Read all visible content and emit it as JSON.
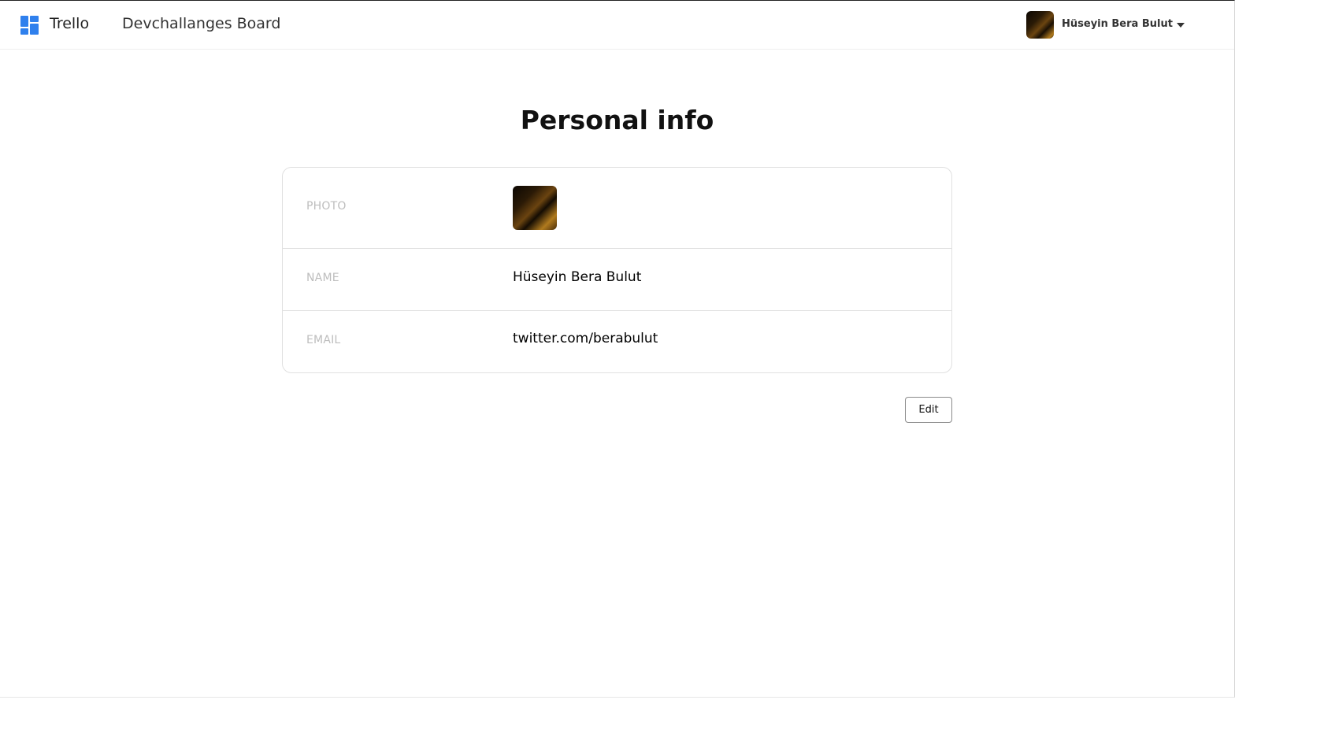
{
  "header": {
    "logo_icon": "trello-grid-icon",
    "brand": "Trello",
    "board_title": "Devchallanges Board",
    "user": {
      "name": "Hüseyin Bera Bulut",
      "avatar_icon": "user-avatar",
      "menu_icon": "caret-down-icon"
    }
  },
  "main": {
    "title": "Personal info",
    "rows": [
      {
        "label": "PHOTO",
        "value": ""
      },
      {
        "label": "NAME",
        "value": "Hüseyin Bera Bulut"
      },
      {
        "label": "EMAIL",
        "value": "twitter.com/berabulut"
      }
    ],
    "edit_label": "Edit"
  },
  "colors": {
    "accent": "#2f80ed",
    "label": "#bdbdbd",
    "border": "#e0e0e0"
  }
}
